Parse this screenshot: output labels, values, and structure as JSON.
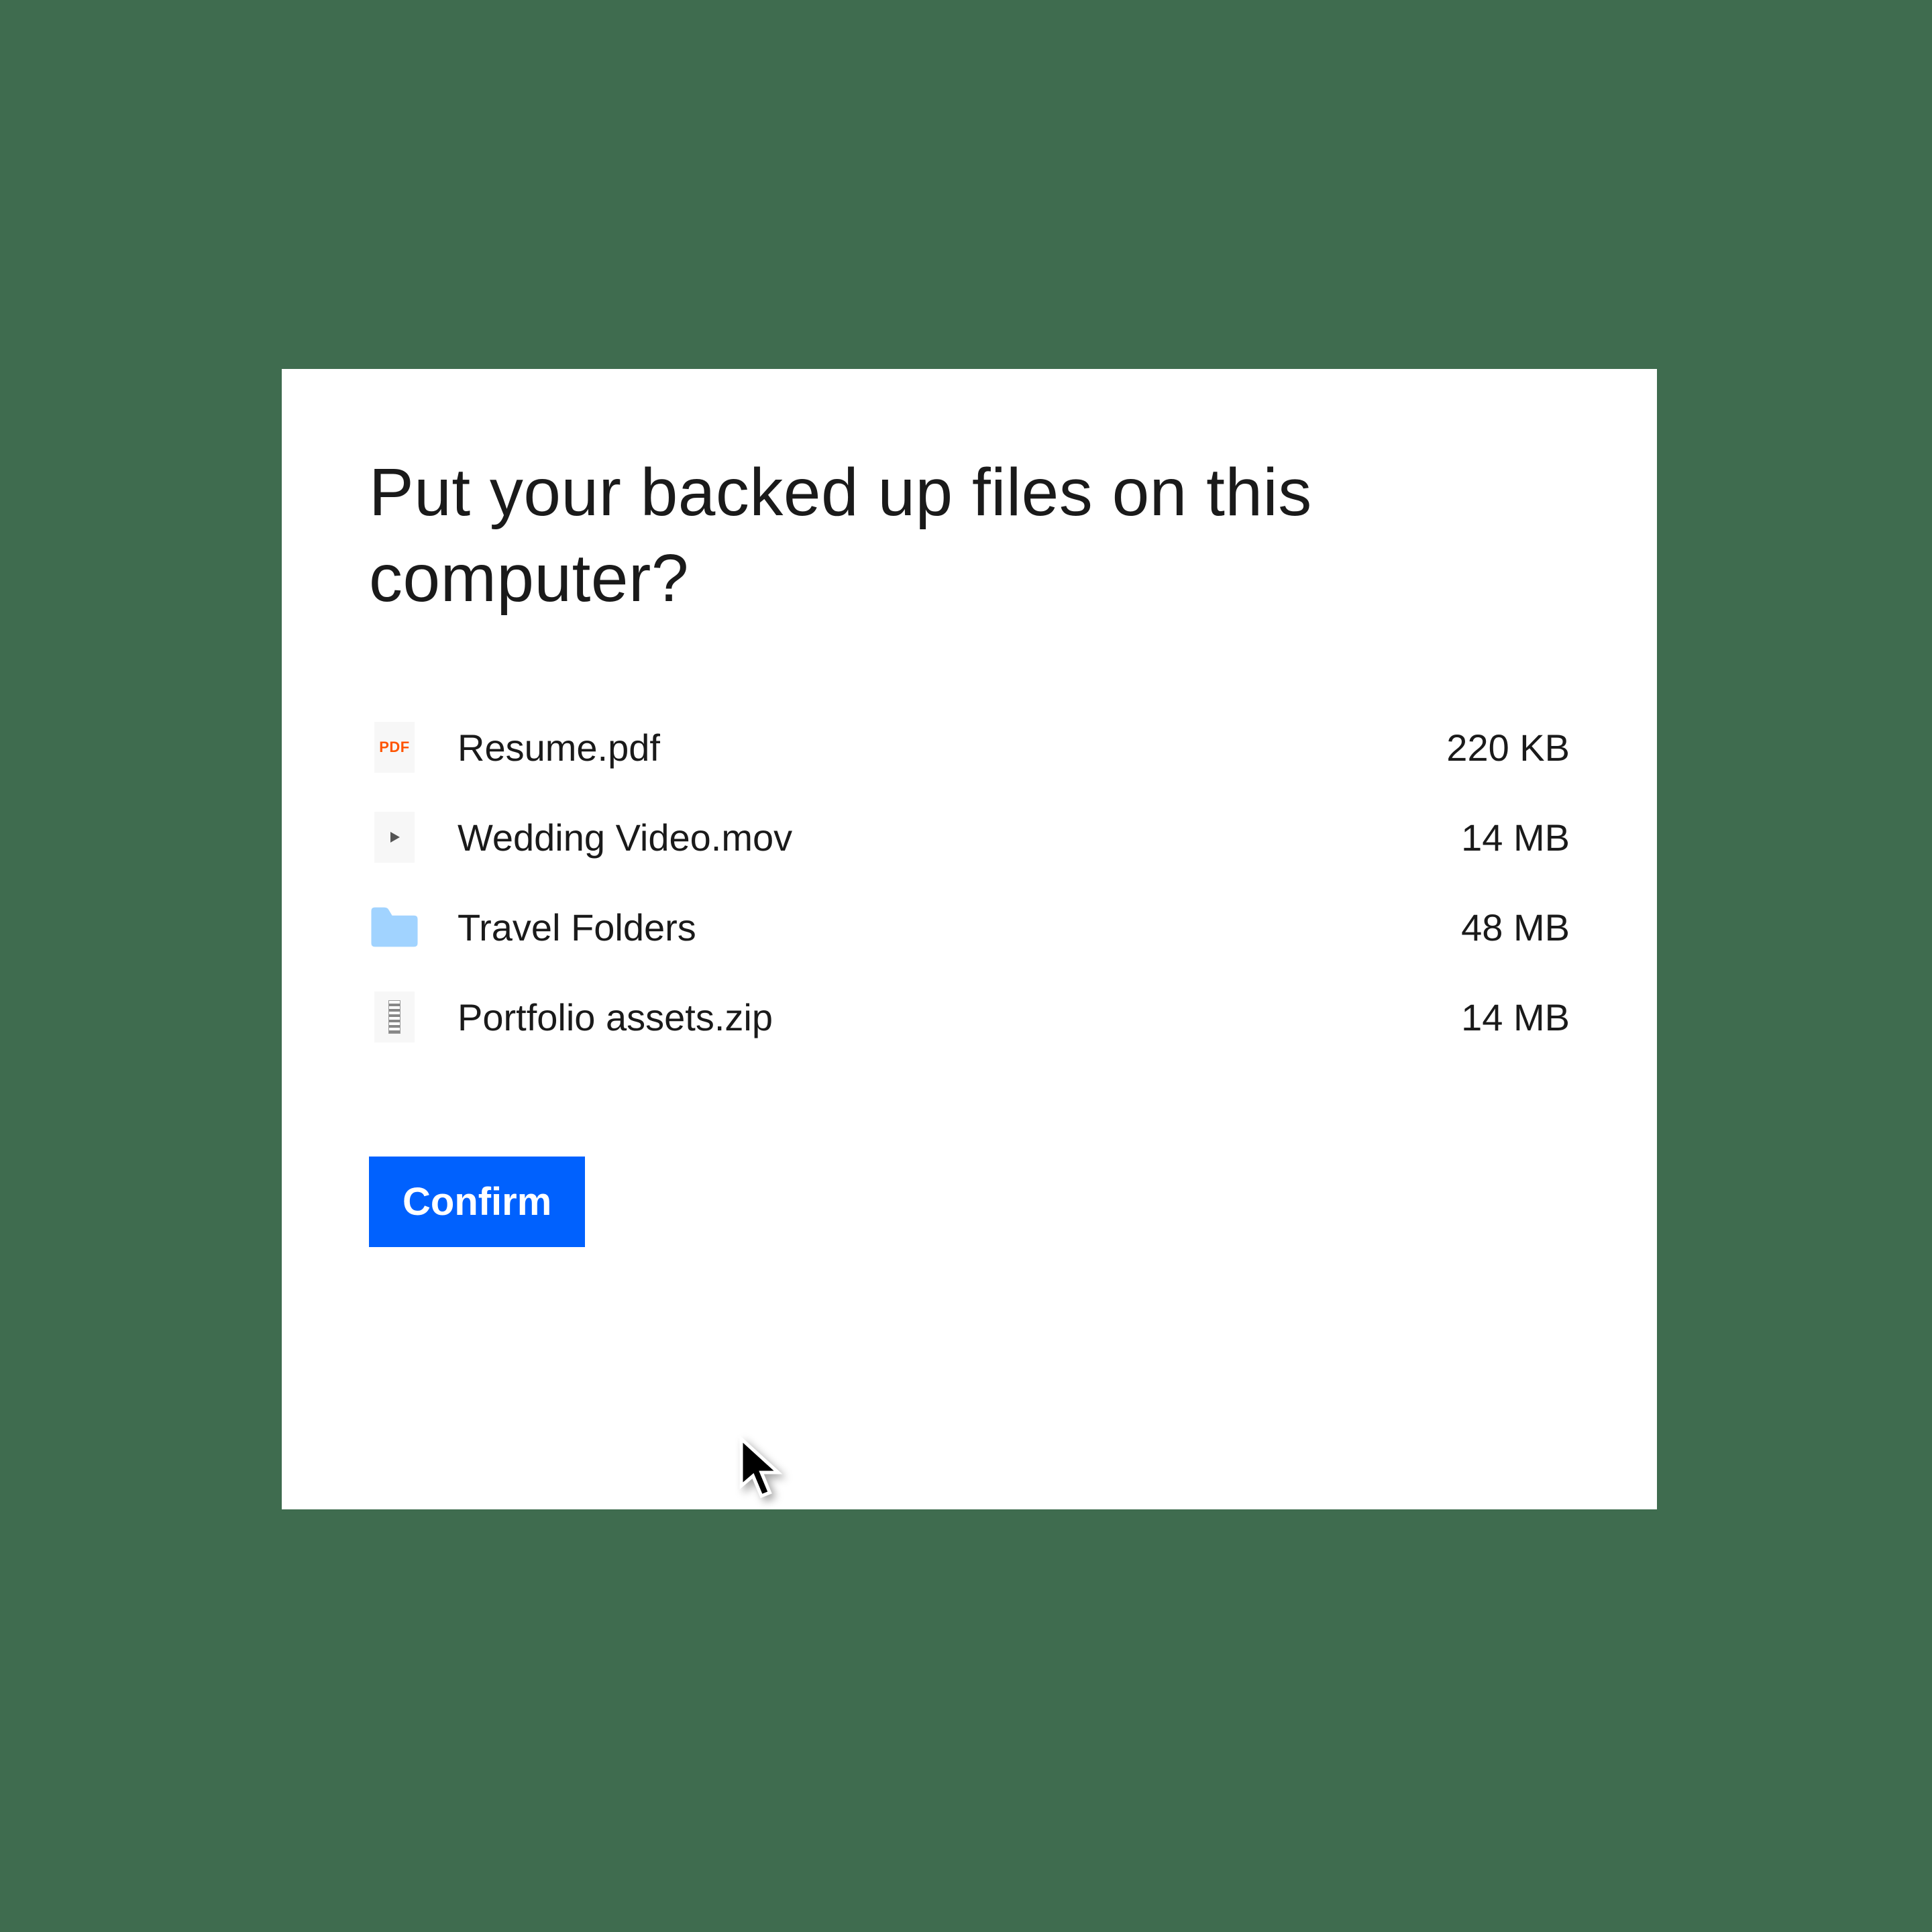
{
  "dialog": {
    "title": "Put your backed up files on this computer?",
    "confirm_label": "Confirm"
  },
  "files": [
    {
      "icon": "pdf",
      "name": "Resume.pdf",
      "size": "220 KB"
    },
    {
      "icon": "video",
      "name": "Wedding Video.mov",
      "size": "14 MB"
    },
    {
      "icon": "folder",
      "name": "Travel Folders",
      "size": "48 MB"
    },
    {
      "icon": "zip",
      "name": "Portfolio assets.zip",
      "size": "14 MB"
    }
  ]
}
